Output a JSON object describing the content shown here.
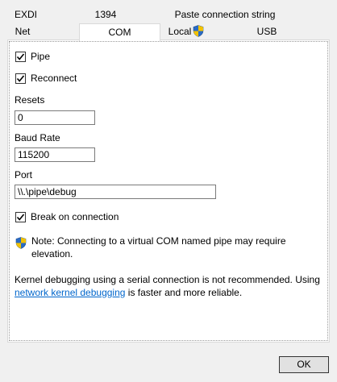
{
  "tabs": {
    "row1": [
      {
        "label": "EXDI"
      },
      {
        "label": "1394"
      },
      {
        "label": "Paste connection string"
      }
    ],
    "row2": [
      {
        "label": "Net"
      },
      {
        "label": "COM",
        "selected": true
      },
      {
        "label": "Local",
        "icon": "uac-shield-icon"
      },
      {
        "label": "USB"
      }
    ]
  },
  "com": {
    "pipe": {
      "label": "Pipe",
      "checked": true
    },
    "reconnect": {
      "label": "Reconnect",
      "checked": true
    },
    "resets": {
      "label": "Resets",
      "value": "0"
    },
    "baud_rate": {
      "label": "Baud Rate",
      "value": "115200"
    },
    "port": {
      "label": "Port",
      "value": "\\\\.\\pipe\\debug"
    },
    "break_on_connection": {
      "label": "Break on connection",
      "checked": true
    },
    "note": {
      "icon": "uac-shield-icon",
      "text": "Note: Connecting to a virtual COM named pipe may require elevation."
    },
    "warning": {
      "before": "Kernel debugging using a serial connection is not recommended. Using ",
      "link": "network kernel debugging",
      "after": " is faster and more reliable."
    }
  },
  "footer": {
    "ok_label": "OK"
  },
  "colors": {
    "panel": "#ffffff",
    "background": "#f0f0f0",
    "link": "#0066cc",
    "shield_blue": "#2b6cc4",
    "shield_yellow": "#f2c200"
  }
}
